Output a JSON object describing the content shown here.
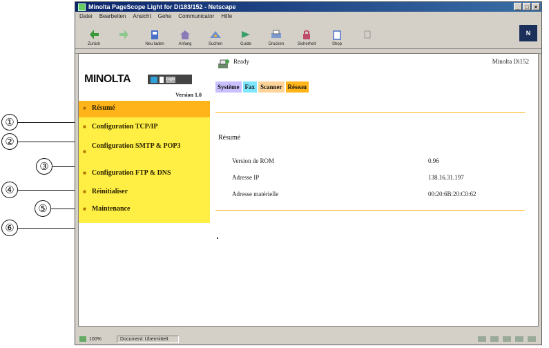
{
  "window": {
    "title": "Minolta PageScope Light for Di183/152 - Netscape",
    "menu": [
      "Datei",
      "Bearbeiten",
      "Ansicht",
      "Gehe",
      "Communicator",
      "Hilfe"
    ],
    "toolbar": [
      "Zurück",
      "",
      "Neu laden",
      "Anfang",
      "Suchen",
      "Guide",
      "Drucken",
      "Sicherheit",
      "Shop",
      ""
    ],
    "brand_mark": "N"
  },
  "callouts": [
    "①",
    "②",
    "③",
    "④",
    "⑤",
    "⑥"
  ],
  "sidebar": {
    "logo": "MINOLTA",
    "badge_label": "Light",
    "version": "Version 1.0",
    "items": [
      {
        "label": "Résumé"
      },
      {
        "label": "Configuration TCP/IP"
      },
      {
        "label": "Configuration SMTP & POP3"
      },
      {
        "label": "Configuration FTP & DNS"
      },
      {
        "label": "Réinitialiser"
      },
      {
        "label": "Maintenance"
      }
    ]
  },
  "main": {
    "status": "Ready",
    "device": "Minolta Di152",
    "tabs": [
      "Système",
      "Fax",
      "Scanner",
      "Réseau"
    ],
    "section_title": "Résumé",
    "rows": [
      {
        "key": "Version de ROM",
        "value": "0.96"
      },
      {
        "key": "Adresse IP",
        "value": "138.16.31.197"
      },
      {
        "key": "Adresse matérielle",
        "value": "00:20:6B:20:C0:62"
      }
    ]
  },
  "statusbar": {
    "left": "100%",
    "doc": "Document: Übermittelt"
  }
}
